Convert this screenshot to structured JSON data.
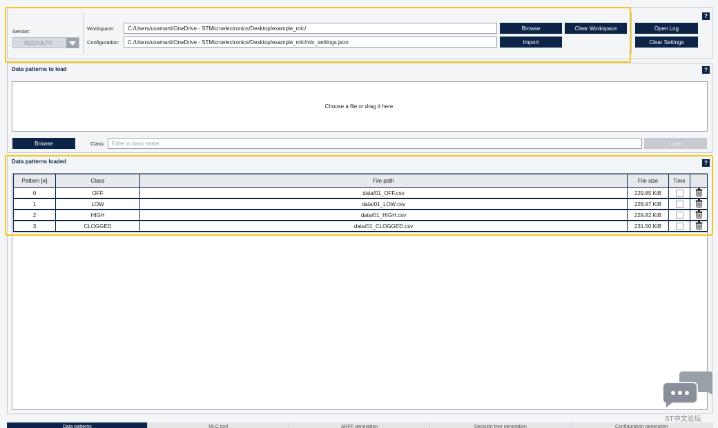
{
  "sensor": {
    "label": "Sensor:",
    "value": "IIS2DULPX"
  },
  "workspace": {
    "label": "Workspace:",
    "path": "C:/Users/uxamarti/OneDrive - STMicroelectronics/Desktop/example_mlc/",
    "browse_label": "Browse",
    "clear_label": "Clear Workspace"
  },
  "configuration": {
    "label": "Configuration:",
    "path": "C:/Users/uxamarti/OneDrive - STMicroelectronics/Desktop/example_mlc/mlc_settings.json",
    "import_label": "Import"
  },
  "side": {
    "open_log_label": "Open Log",
    "clear_settings_label": "Clear Settings"
  },
  "help_label": "?",
  "patterns_to_load": {
    "title": "Data patterns to load",
    "dropzone_text": "Choose a file or drag it here.",
    "browse_label": "Browse",
    "class_label": "Class:",
    "class_placeholder": "Enter a class name",
    "load_label": "Load"
  },
  "patterns_loaded": {
    "title": "Data patterns loaded",
    "columns": [
      "Pattern [#]",
      "Class",
      "File path",
      "File size",
      "Time",
      ""
    ],
    "rows": [
      {
        "pattern": "0",
        "class": "OFF",
        "path": "data/01_OFF.csv",
        "size": "229.85 KiB"
      },
      {
        "pattern": "1",
        "class": "LOW",
        "path": "data/01_LOW.csv",
        "size": "228.97 KiB"
      },
      {
        "pattern": "2",
        "class": "HIGH",
        "path": "data/01_HIGH.csv",
        "size": "229.82 KiB"
      },
      {
        "pattern": "3",
        "class": "CLOGGED",
        "path": "data/01_CLOGGED.csv",
        "size": "231.50 KiB"
      }
    ]
  },
  "tabs": [
    "Data patterns",
    "MLC tool",
    "ARFF generation",
    "Decision tree generation",
    "Configuration generation"
  ],
  "watermark": {
    "text": "ST中文论坛"
  },
  "colors": {
    "primary": "#0b2447",
    "highlight": "#f5c518",
    "background": "#f4f5f7"
  }
}
